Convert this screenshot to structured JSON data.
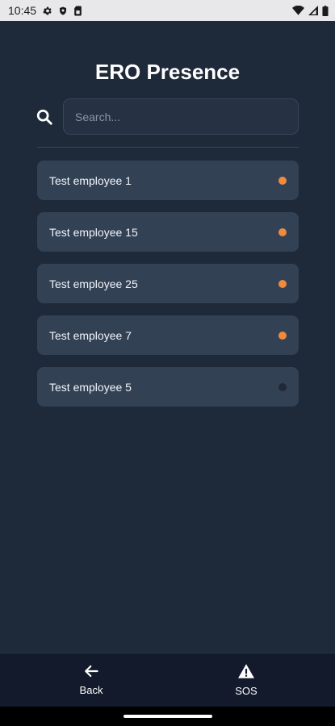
{
  "status_bar": {
    "time": "10:45",
    "icons": [
      "settings-icon",
      "shield-icon",
      "sim-card-icon",
      "wifi-icon",
      "signal-icon",
      "battery-icon"
    ]
  },
  "header": {
    "title": "ERO Presence"
  },
  "search": {
    "placeholder": "Search...",
    "value": "",
    "icon": "search-icon"
  },
  "employees": [
    {
      "name": "Test employee 1",
      "status_color": "#f08a3c"
    },
    {
      "name": "Test employee 15",
      "status_color": "#f08a3c"
    },
    {
      "name": "Test employee 25",
      "status_color": "#f08a3c"
    },
    {
      "name": "Test employee 7",
      "status_color": "#f08a3c"
    },
    {
      "name": "Test employee 5",
      "status_color": "#1f2937"
    }
  ],
  "bottom_nav": {
    "back_label": "Back",
    "back_icon": "arrow-left-icon",
    "sos_label": "SOS",
    "sos_icon": "warning-icon"
  },
  "colors": {
    "background": "#1e2939",
    "card": "#334155",
    "nav": "#121a2b",
    "present": "#f08a3c",
    "absent": "#1f2937"
  }
}
